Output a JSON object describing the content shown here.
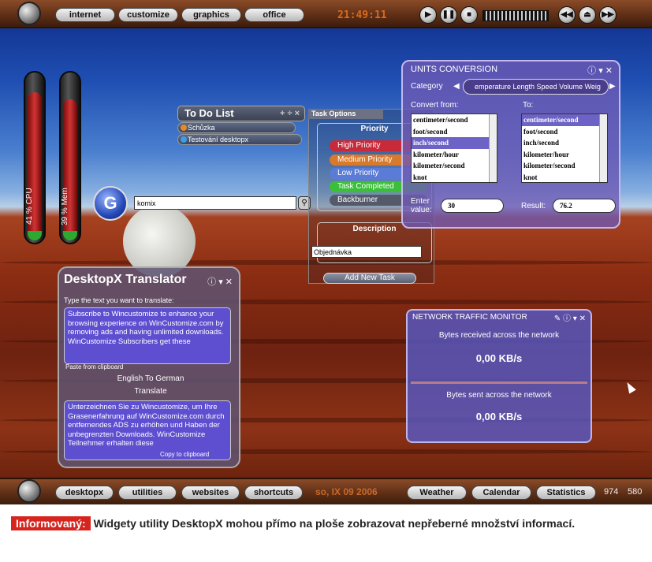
{
  "top_bar": {
    "tabs": [
      "internet",
      "customize",
      "graphics",
      "office"
    ],
    "clock": "21:49:11"
  },
  "bottom_bar": {
    "tabs": [
      "desktopx",
      "utilities",
      "websites",
      "shortcuts"
    ],
    "date": "so, IX 09 2006",
    "right_tabs": [
      "Weather",
      "Calendar",
      "Statistics"
    ],
    "numbers": [
      "974",
      "580"
    ]
  },
  "gauges": {
    "cpu": "41 % CPU",
    "mem": "39 % Mem",
    "cpu_level": 0.41,
    "mem_level": 0.39
  },
  "search": {
    "logo": "G",
    "value": "komix"
  },
  "todo": {
    "title": "To Do List",
    "items": [
      "Schůzka",
      "Testování desktopx"
    ]
  },
  "task_options": {
    "title": "Task Options",
    "priority_title": "Priority",
    "priorities": [
      {
        "label": "High Priority",
        "color": "#c92a3a"
      },
      {
        "label": "Medium Priority",
        "color": "#d8792c"
      },
      {
        "label": "Low Priority",
        "color": "#5a7bd6"
      },
      {
        "label": "Task Completed",
        "color": "#3bbf3b"
      },
      {
        "label": "Backburner",
        "color": "#555a6a"
      }
    ],
    "description_title": "Description",
    "description_value": "Objednávka",
    "add_button": "Add New Task"
  },
  "units": {
    "title": "UNITS CONVERSION",
    "category_label": "Category",
    "categories": "emperature Length Speed Volume Weig",
    "from_label": "Convert from:",
    "to_label": "To:",
    "from_items": [
      "centimeter/second",
      "foot/second",
      "inch/second",
      "kilometer/hour",
      "kilometer/second",
      "knot"
    ],
    "to_items": [
      "centimeter/second",
      "foot/second",
      "inch/second",
      "kilometer/hour",
      "kilometer/second",
      "knot"
    ],
    "enter_label": "Enter value:",
    "enter_value": "30",
    "result_label": "Result:",
    "result_value": "76.2"
  },
  "network": {
    "title": "NETWORK TRAFFIC MONITOR",
    "received_label": "Bytes received across the network",
    "received_value": "0,00 KB/s",
    "sent_label": "Bytes sent across the network",
    "sent_value": "0,00 KB/s"
  },
  "translator": {
    "title": "DesktopX Translator",
    "instruction": "Type the text you want to translate:",
    "input_text": "Subscribe to Wincustomize to enhance your browsing experience on WinCustomize.com by removing ads and having unlimited downloads. WinCustomize Subscribers get these",
    "paste_label": "Paste from clipboard",
    "language": "English To German",
    "translate_button": "Translate",
    "output_text": "Unterzeichnen Sie zu Wincustomize, um Ihre Grasenerfahrung auf WinCustomize.com durch entfernendes ADS zu erhöhen und Haben der unbegrenzten Downloads. WinCustomize Teilnehmer erhalten diese",
    "copy_label": "Copy to clipboard"
  },
  "caption": {
    "tag": "Informovaný:",
    "text": "Widgety utility DesktopX mohou přímo na ploše zobrazovat nepřeberné množství informací."
  }
}
